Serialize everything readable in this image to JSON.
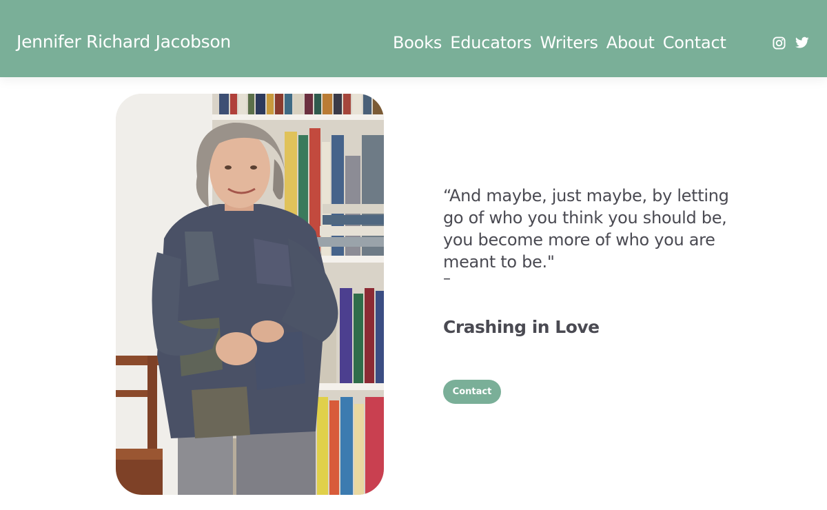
{
  "header": {
    "site_title": "Jennifer Richard Jacobson",
    "nav": [
      "Books",
      "Educators",
      "Writers",
      "About",
      "Contact"
    ],
    "social_icons": [
      "instagram-icon",
      "twitter-icon"
    ]
  },
  "hero": {
    "quote": "“And maybe, just maybe, by letting go of who you think you should be, you become more of who you are meant to be.\"",
    "attribution_dash": "–",
    "book_title": "Crashing in Love",
    "contact_label": "Contact"
  },
  "colors": {
    "header_bg": "#7aaf98",
    "button_bg": "#7aaf98",
    "text": "#4a4a52",
    "background": "#ffffff"
  }
}
